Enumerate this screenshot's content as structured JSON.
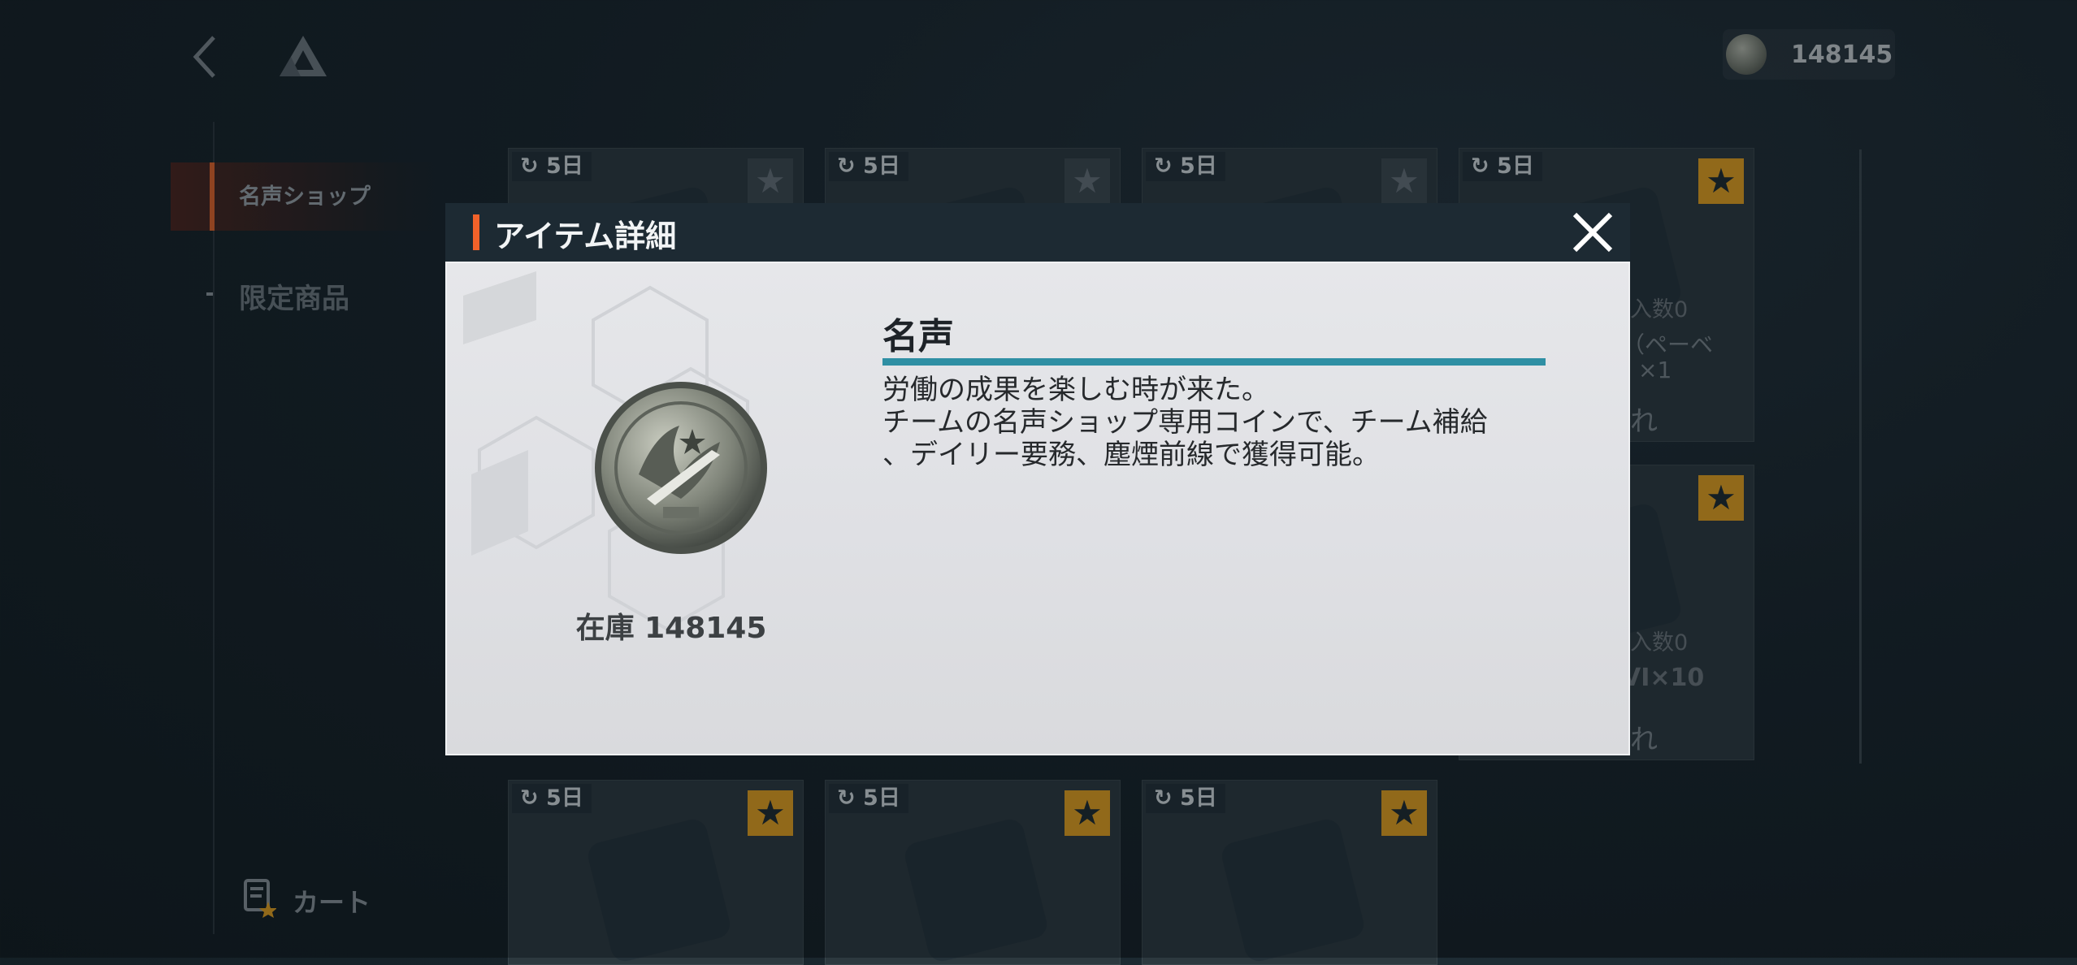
{
  "header": {
    "currency_amount": "148145"
  },
  "sidebar": {
    "items": [
      {
        "label": "名声ショップ",
        "active": true
      },
      {
        "label": "限定商品",
        "active": false
      }
    ],
    "cart_label": "カート"
  },
  "shop": {
    "cards": [
      {
        "timer": "5日",
        "favorite": false
      },
      {
        "timer": "5日",
        "favorite": false
      },
      {
        "timer": "5日",
        "favorite": false
      },
      {
        "timer": "5日",
        "favorite": true
      },
      {
        "timer": "5日",
        "favorite": true
      },
      {
        "timer": "5日",
        "favorite": true
      },
      {
        "timer": "5日",
        "favorite": true
      },
      {
        "timer": "5日",
        "favorite": true
      }
    ],
    "partial_text": [
      "入数0",
      "（ペーベ",
      "×1",
      "れ",
      "入数0",
      "VI×10",
      "れ"
    ]
  },
  "dialog": {
    "title": "アイテム詳細",
    "item_name": "名声",
    "description_lines": [
      "労働の成果を楽しむ時が来た。",
      "チームの名声ショップ専用コインで、チーム補給",
      "、デイリー要務、塵煙前線で獲得可能。"
    ],
    "stock_label": "在庫 148145"
  },
  "colors": {
    "accent_orange": "#f1622a",
    "rule_teal": "#2f8fa4",
    "favorite_gold": "#e6a21f"
  }
}
